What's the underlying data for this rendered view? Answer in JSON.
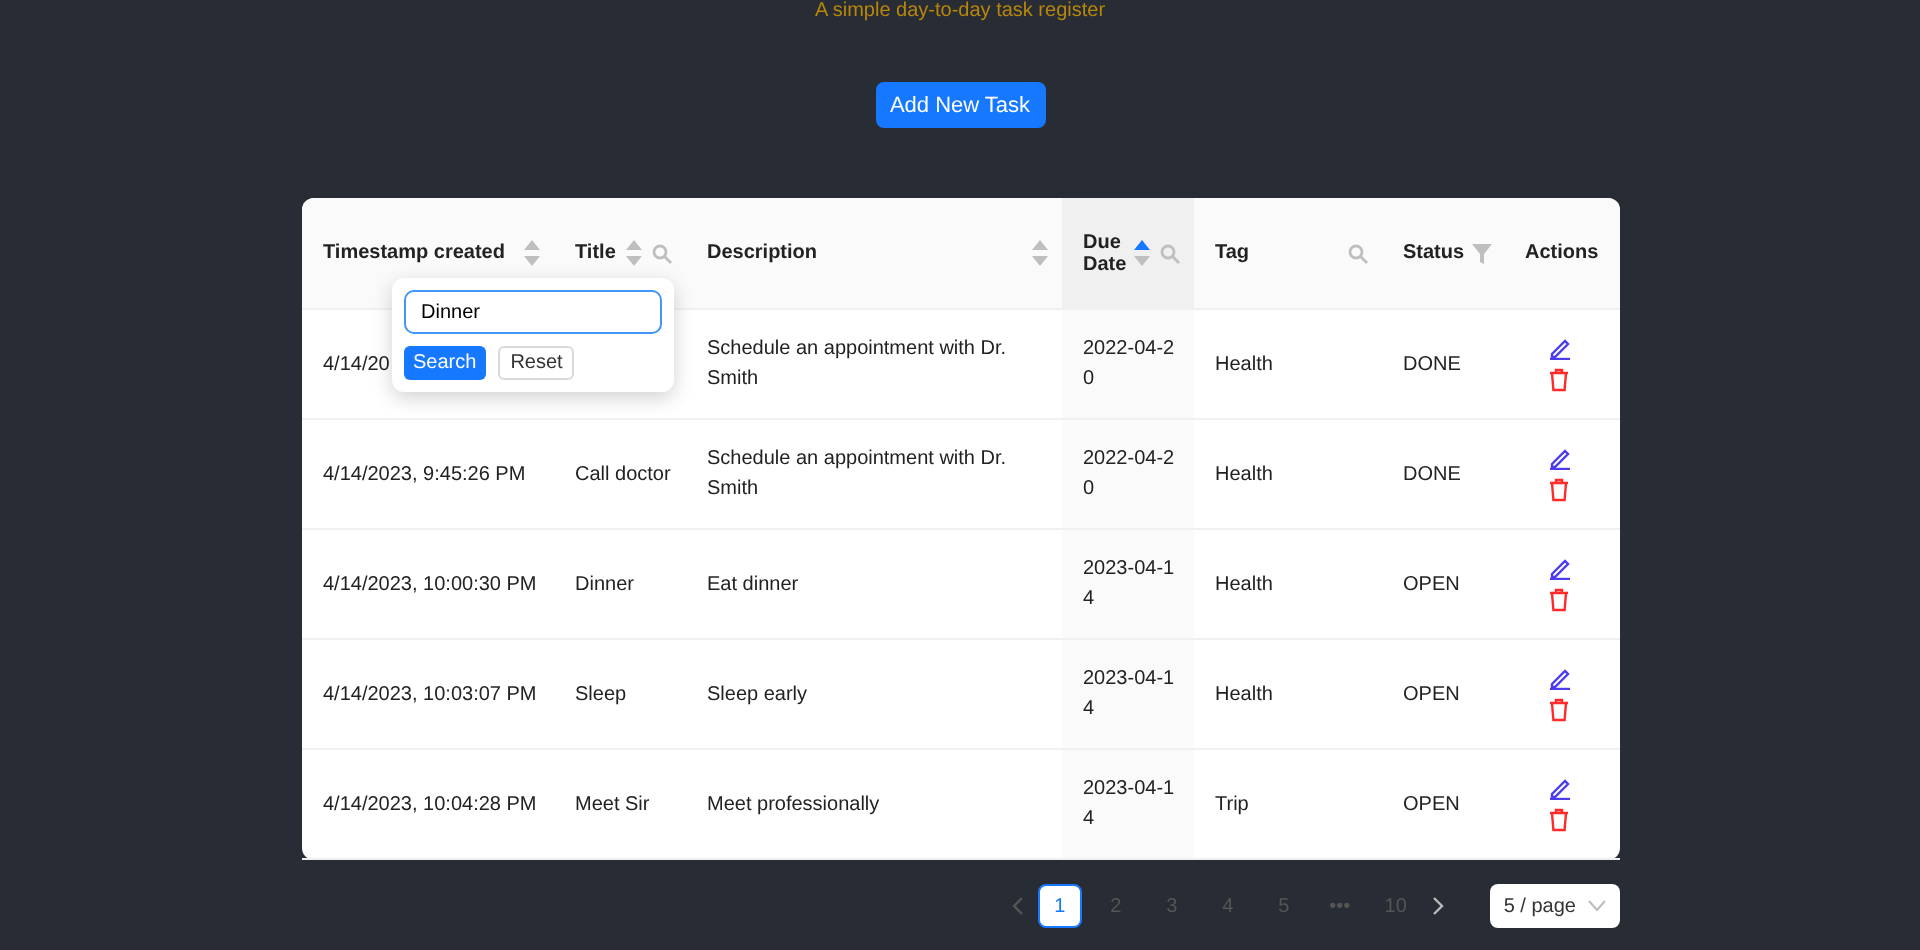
{
  "subtitle": "A simple day-to-day task register",
  "add_button": "Add New Task",
  "table": {
    "columns": [
      {
        "label": "Timestamp created",
        "sorted": false
      },
      {
        "label": "Title",
        "sorted": false,
        "search": true
      },
      {
        "label": "Description",
        "sorted": false
      },
      {
        "label": "Due Date",
        "sorted": true,
        "search": true
      },
      {
        "label": "Tag",
        "search": true
      },
      {
        "label": "Status",
        "filter": true
      },
      {
        "label": "Actions"
      }
    ],
    "rows": [
      {
        "timestamp": "4/14/20",
        "description": "Schedule an appointment with Dr. Smith",
        "due": "2022-04-20",
        "tag": "Health",
        "status": "DONE"
      },
      {
        "timestamp": "4/14/2023, 9:45:26 PM",
        "title": "Call doctor",
        "description": "Schedule an appointment with Dr. Smith",
        "due": "2022-04-20",
        "tag": "Health",
        "status": "DONE"
      },
      {
        "timestamp": "4/14/2023, 10:00:30 PM",
        "title": "Dinner",
        "description": "Eat dinner",
        "due": "2023-04-14",
        "tag": "Health",
        "status": "OPEN"
      },
      {
        "timestamp": "4/14/2023, 10:03:07 PM",
        "title": "Sleep",
        "description": "Sleep early",
        "due": "2023-04-14",
        "tag": "Health",
        "status": "OPEN"
      },
      {
        "timestamp": "4/14/2023, 10:04:28 PM",
        "title": "Meet Sir",
        "description": "Meet professionally",
        "due": "2023-04-14",
        "tag": "Trip",
        "status": "OPEN"
      }
    ]
  },
  "search_popup": {
    "value": "Dinner",
    "search_button": "Search",
    "reset_button": "Reset"
  },
  "pagination": {
    "pages": [
      {
        "label": "1",
        "selected": true
      },
      {
        "label": "2",
        "selected": false
      },
      {
        "label": "3",
        "selected": false
      },
      {
        "label": "4",
        "selected": false
      },
      {
        "label": "5",
        "selected": false
      },
      {
        "label": "•••",
        "selected": false
      },
      {
        "label": "10",
        "selected": false
      }
    ],
    "page_size": "5 / page"
  }
}
